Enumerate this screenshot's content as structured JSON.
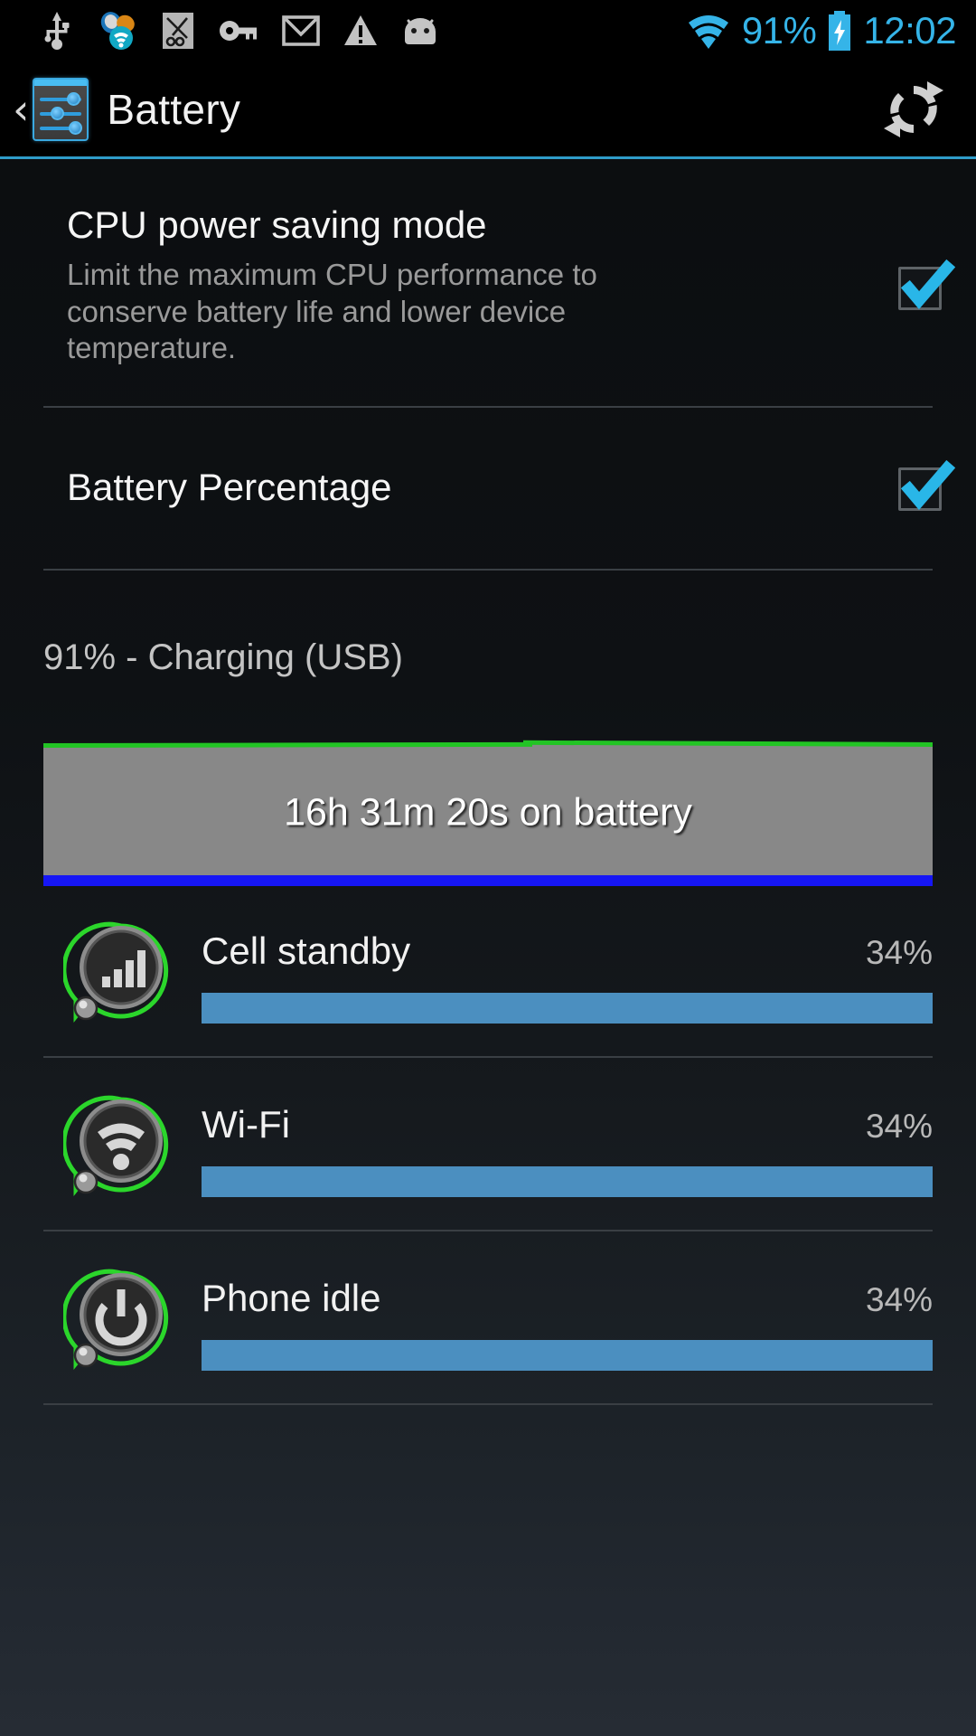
{
  "status_bar": {
    "icons": [
      {
        "name": "usb-icon",
        "label": "USB"
      },
      {
        "name": "sync-apps-icon",
        "label": "Sync"
      },
      {
        "name": "screenshot-icon",
        "label": "Screenshot"
      },
      {
        "name": "vpn-key-icon",
        "label": "VPN key"
      },
      {
        "name": "gmail-icon",
        "label": "Gmail"
      },
      {
        "name": "warning-icon",
        "label": "Warning"
      },
      {
        "name": "android-icon",
        "label": "Android"
      }
    ],
    "wifi_icon": "wifi-icon",
    "battery_percent": "91%",
    "battery_icon": "battery-charging-icon",
    "clock": "12:02",
    "accent_color": "#35b4e8"
  },
  "action_bar": {
    "back_label": "‹",
    "app_icon": "settings-sliders-icon",
    "title": "Battery",
    "refresh_icon": "refresh-icon"
  },
  "settings": [
    {
      "name": "cpu-power-saving-mode",
      "title": "CPU power saving mode",
      "summary": "Limit the maximum CPU performance to conserve battery life and lower device temperature.",
      "checked": true
    },
    {
      "name": "battery-percentage",
      "title": "Battery Percentage",
      "summary": "",
      "checked": true
    }
  ],
  "battery_status": "91% - Charging (USB)",
  "chart": {
    "label": "16h 31m 20s on battery",
    "top_line_color": "#22c424",
    "fill_color": "#888888",
    "bottom_line_color": "#1616f5"
  },
  "usage": {
    "bar_color": "#4b8fc0",
    "items": [
      {
        "name": "cell-standby",
        "icon": "signal-bars-icon",
        "label": "Cell standby",
        "percent": "34%",
        "value": 34
      },
      {
        "name": "wifi",
        "icon": "wifi-icon",
        "label": "Wi-Fi",
        "percent": "34%",
        "value": 34
      },
      {
        "name": "phone-idle",
        "icon": "power-icon",
        "label": "Phone idle",
        "percent": "34%",
        "value": 34
      }
    ]
  }
}
